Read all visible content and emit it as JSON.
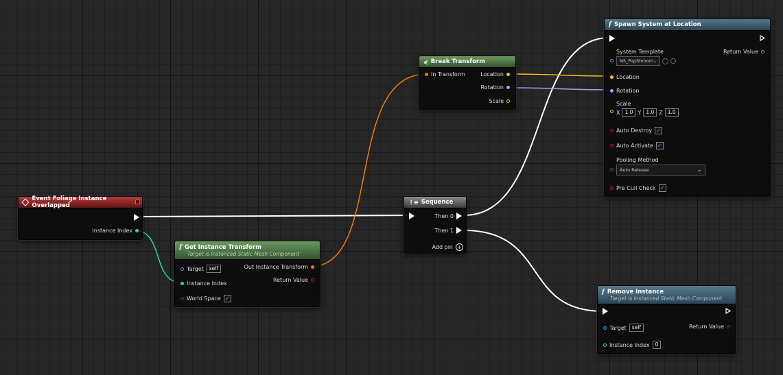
{
  "nodes": {
    "event": {
      "title": "Event Foliage Instance Overlapped",
      "pins": {
        "instance_index": "Instance Index"
      }
    },
    "get_transform": {
      "title": "Get Instance Transform",
      "subtitle": "Target is Instanced Static Mesh Component",
      "pins": {
        "target": "Target",
        "target_value": "self",
        "instance_index": "Instance Index",
        "world_space": "World Space",
        "out_transform": "Out Instance Transform",
        "return_value": "Return Value"
      }
    },
    "break_transform": {
      "title": "Break Transform",
      "pins": {
        "in_transform": "In Transform",
        "location": "Location",
        "rotation": "Rotation",
        "scale": "Scale"
      }
    },
    "sequence": {
      "title": "Sequence",
      "pins": {
        "then0": "Then 0",
        "then1": "Then 1",
        "add_pin": "Add pin"
      }
    },
    "spawn": {
      "title": "Spawn System at Location",
      "pins": {
        "system_template": "System Template",
        "system_template_value": "NS_PopShroom",
        "return_value": "Return Value",
        "location": "Location",
        "rotation": "Rotation",
        "scale": "Scale",
        "scale_x_label": "X",
        "scale_x": "1.0",
        "scale_y_label": "Y",
        "scale_y": "1.0",
        "scale_z_label": "Z",
        "scale_z": "1.0",
        "auto_destroy": "Auto Destroy",
        "auto_activate": "Auto Activate",
        "pooling_method": "Pooling Method",
        "pooling_value": "Auto Release",
        "pre_cull_check": "Pre Cull Check"
      }
    },
    "remove": {
      "title": "Remove Instance",
      "subtitle": "Target is Instanced Static Mesh Component",
      "pins": {
        "target": "Target",
        "target_value": "self",
        "return_value": "Return Value",
        "instance_index": "Instance Index",
        "instance_index_value": "0"
      }
    }
  },
  "colors": {
    "exec": "#ffffff",
    "transform": "#f07a10",
    "vector": "#f5c518",
    "rotator": "#9aa5ff",
    "object": "#37a6e8",
    "integer": "#20d8a0",
    "boolean": "#9a1a1a",
    "byte": "#0f6f66"
  },
  "checkmark": "✓"
}
